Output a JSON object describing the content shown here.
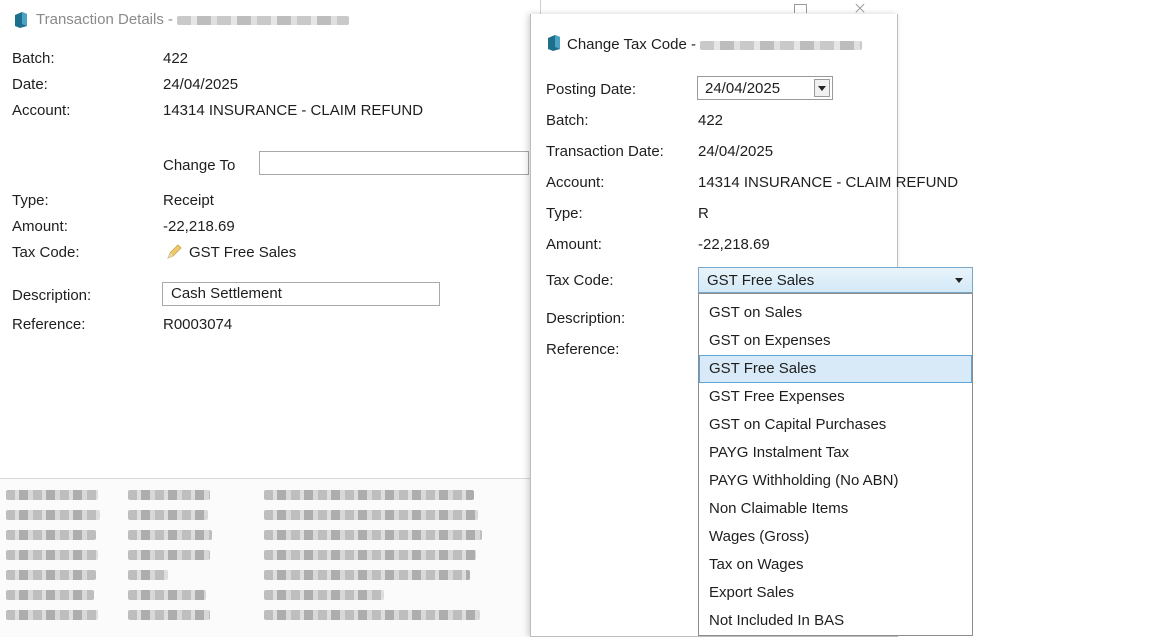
{
  "txn_window": {
    "title": "Transaction Details -",
    "fields": [
      {
        "label": "Batch:",
        "value": "422"
      },
      {
        "label": "Date:",
        "value": "24/04/2025"
      },
      {
        "label": "Account:",
        "value": "14314 INSURANCE - CLAIM REFUND"
      },
      {
        "label": "Type:",
        "value": "Receipt"
      },
      {
        "label": "Amount:",
        "value": "-22,218.69"
      },
      {
        "label": "Tax Code:",
        "value": "GST Free Sales"
      },
      {
        "label": "Description:",
        "value": "Cash Settlement"
      },
      {
        "label": "Reference:",
        "value": "R0003074"
      }
    ],
    "change_to_label": "Change To",
    "change_to_value": ""
  },
  "tax_window": {
    "title": "Change Tax Code -",
    "posting_date_label": "Posting Date:",
    "posting_date": "24/04/2025",
    "fields": [
      {
        "label": "Batch:",
        "value": "422"
      },
      {
        "label": "Transaction Date:",
        "value": "24/04/2025"
      },
      {
        "label": "Account:",
        "value": "14314 INSURANCE - CLAIM REFUND"
      },
      {
        "label": "Type:",
        "value": "R"
      },
      {
        "label": "Amount:",
        "value": "-22,218.69"
      }
    ],
    "tax_code_label": "Tax Code:",
    "tax_code_selected": "GST Free Sales",
    "description_label": "Description:",
    "reference_label": "Reference:",
    "tax_code_options": [
      "GST on Sales",
      "GST on Expenses",
      "GST Free Sales",
      "GST Free Expenses",
      "GST on Capital Purchases",
      "PAYG Instalment Tax",
      "PAYG Withholding (No ABN)",
      "Non Claimable Items",
      "Wages (Gross)",
      "Tax on Wages",
      "Export Sales",
      "Not Included In BAS"
    ],
    "selected_index": 2
  },
  "colors": {
    "selection_fill": "#d8eaf7",
    "selection_border": "#5fa4d6",
    "icon_accent": "#1d6f8c"
  }
}
